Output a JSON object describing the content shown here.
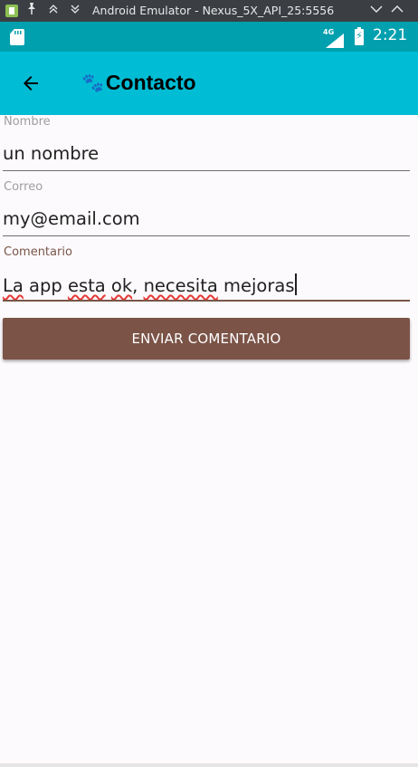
{
  "window": {
    "title": "Android Emulator - Nexus_5X_API_25:5556",
    "pin_icon": "pin-icon",
    "up_icon": "double-chevron-up-icon",
    "down_icon": "double-chevron-down-icon",
    "minimize_icon": "chevron-down-icon",
    "maximize_icon": "chevron-up-icon"
  },
  "status_bar": {
    "network_label": "4G",
    "time": "2:21",
    "background": "#00a0ae"
  },
  "app_bar": {
    "title": "Contacto",
    "title_icon": "paw-icon",
    "back_icon": "arrow-back-icon",
    "background": "#00bcd4"
  },
  "form": {
    "name_field": {
      "label": "Nombre",
      "value": "un nombre"
    },
    "email_field": {
      "label": "Correo",
      "value": "my@email.com"
    },
    "comment_field": {
      "label": "Comentario",
      "value_parts": [
        "La",
        " ",
        "app",
        " ",
        "esta",
        " ",
        "ok",
        ", ",
        "necesita",
        " mejoras"
      ]
    },
    "submit_label": "ENVIAR COMENTARIO",
    "accent": "#795548",
    "button_color": "#7b5347"
  }
}
